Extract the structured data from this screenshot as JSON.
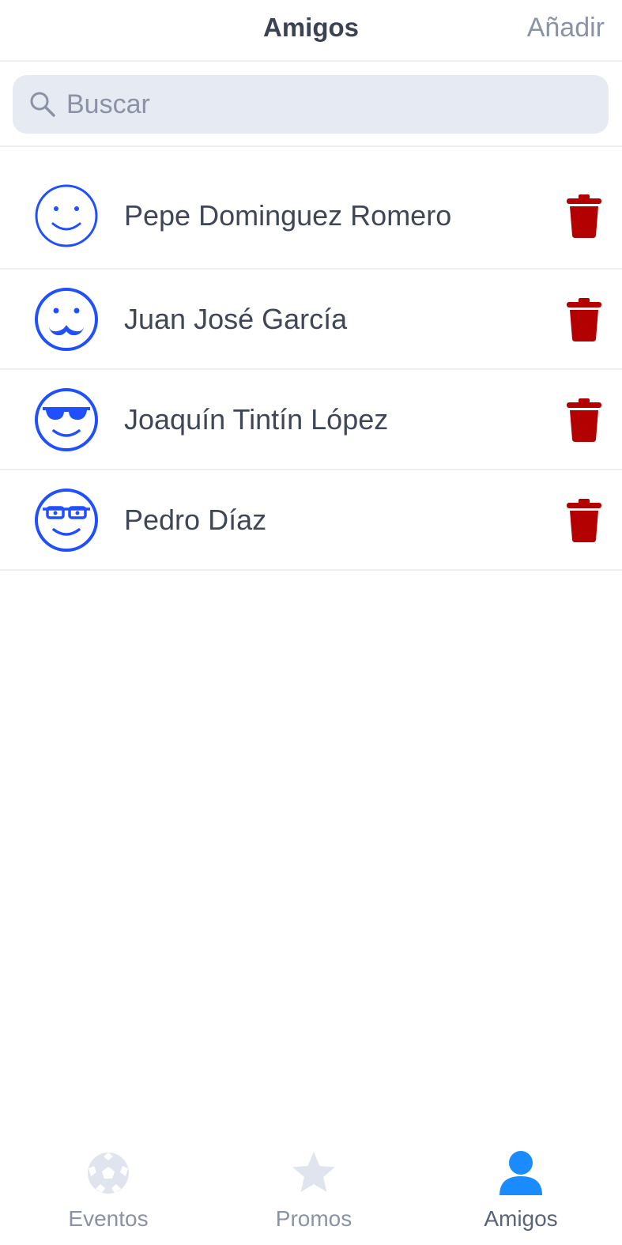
{
  "header": {
    "title": "Amigos",
    "add_label": "Añadir"
  },
  "search": {
    "placeholder": "Buscar",
    "value": ""
  },
  "friends": [
    {
      "name": "Pepe Dominguez Romero",
      "avatar": "smiley-icon"
    },
    {
      "name": "Juan José García",
      "avatar": "mustache-face-icon"
    },
    {
      "name": "Joaquín Tintín López",
      "avatar": "sunglasses-face-icon"
    },
    {
      "name": "Pedro Díaz",
      "avatar": "glasses-face-icon"
    }
  ],
  "tabs": [
    {
      "label": "Eventos",
      "icon": "soccer-ball-icon",
      "active": false
    },
    {
      "label": "Promos",
      "icon": "star-icon",
      "active": false
    },
    {
      "label": "Amigos",
      "icon": "person-icon",
      "active": true
    }
  ],
  "colors": {
    "avatar_blue": "#1f4fff",
    "delete_red": "#b30000",
    "active_tab_blue": "#1a8cff",
    "inactive_tab": "#dfe4ee",
    "text_dark": "#3f4656",
    "text_muted": "#8a93a6",
    "search_bg": "#e6eaf2"
  }
}
